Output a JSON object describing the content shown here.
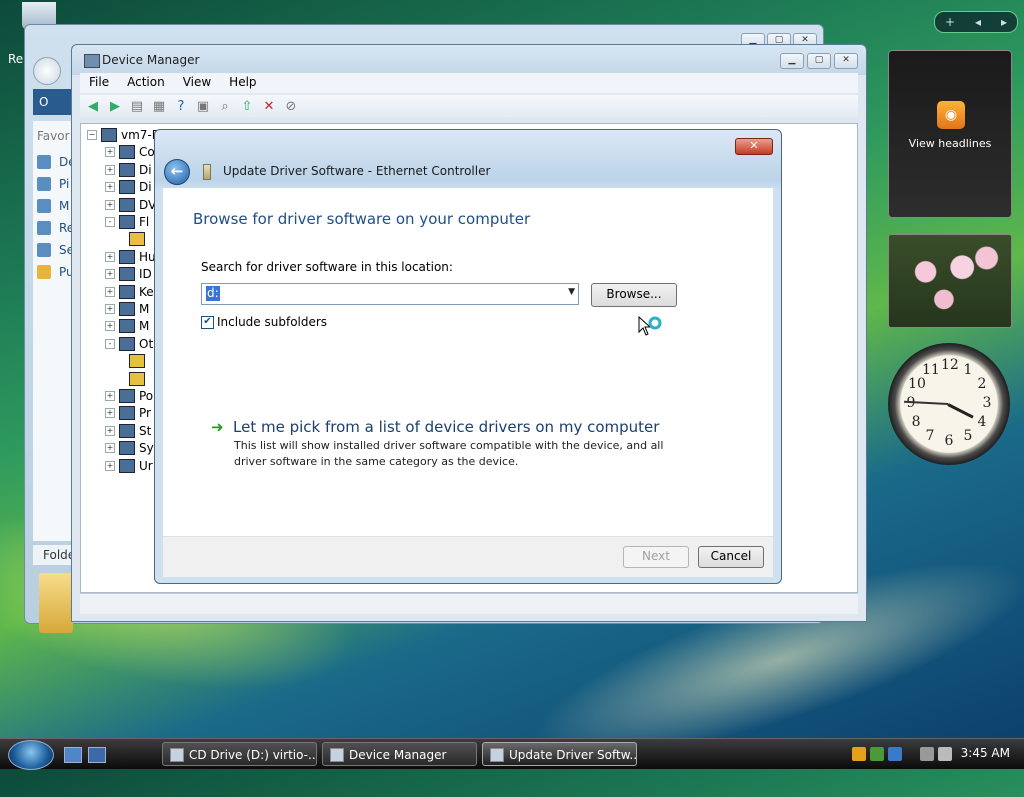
{
  "colors": {
    "dialog_heading": "#1f4f87",
    "link": "#1b3f6f",
    "selection": "#3875d7",
    "taskbar": "#1a1a1a"
  },
  "desktop": {
    "recycle_bin_label": "Re"
  },
  "explorer": {
    "nav_label": "O",
    "sidebar_header": "Favor",
    "sidebar_items": [
      "De",
      "Pi",
      "M",
      "Re",
      "Se",
      "Pu"
    ],
    "folders_label": "Folde"
  },
  "device_manager": {
    "title": "Device Manager",
    "menu": [
      "File",
      "Action",
      "View",
      "Help"
    ],
    "tree": {
      "root": "vm7-P",
      "items": [
        {
          "label": "Co",
          "expand": "+"
        },
        {
          "label": "Di",
          "expand": "+"
        },
        {
          "label": "Di",
          "expand": "+"
        },
        {
          "label": "DV",
          "expand": "+"
        },
        {
          "label": "Fl",
          "expand": "-"
        },
        {
          "label": "",
          "expand": ""
        },
        {
          "label": "Hu",
          "expand": "+"
        },
        {
          "label": "ID",
          "expand": "+"
        },
        {
          "label": "Ke",
          "expand": "+"
        },
        {
          "label": "M",
          "expand": "+"
        },
        {
          "label": "M",
          "expand": "+"
        },
        {
          "label": "Ot",
          "expand": "-"
        },
        {
          "label": "",
          "expand": ""
        },
        {
          "label": "",
          "expand": ""
        },
        {
          "label": "Po",
          "expand": "+"
        },
        {
          "label": "Pr",
          "expand": "+"
        },
        {
          "label": "St",
          "expand": "+"
        },
        {
          "label": "Sy",
          "expand": "+"
        },
        {
          "label": "Ur",
          "expand": "+"
        }
      ]
    }
  },
  "dialog": {
    "title": "Update Driver Software - Ethernet Controller",
    "close_label": "✕",
    "heading": "Browse for driver software on your computer",
    "search_label": "Search for driver software in this location:",
    "path_value": "d:",
    "browse_label": "Browse...",
    "include_subfolders": {
      "label": "Include subfolders",
      "checked": true
    },
    "pick_link": "Let me pick from a list of device drivers on my computer",
    "pick_description": "This list will show installed driver software compatible with the device, and all driver software in the same category as the device.",
    "next_label": "Next",
    "cancel_label": "Cancel"
  },
  "gadgets": {
    "control": {
      "add": "+",
      "prev": "◂",
      "next": "▸"
    },
    "feed_label": "View headlines",
    "clock_numbers": [
      "12",
      "1",
      "2",
      "3",
      "4",
      "5",
      "6",
      "7",
      "8",
      "9",
      "10",
      "11"
    ]
  },
  "taskbar": {
    "tasks": [
      {
        "label": "CD Drive (D:) virtio-...",
        "active": false
      },
      {
        "label": "Device Manager",
        "active": false
      },
      {
        "label": "Update Driver Softw...",
        "active": true
      }
    ],
    "time": "3:45 AM"
  }
}
